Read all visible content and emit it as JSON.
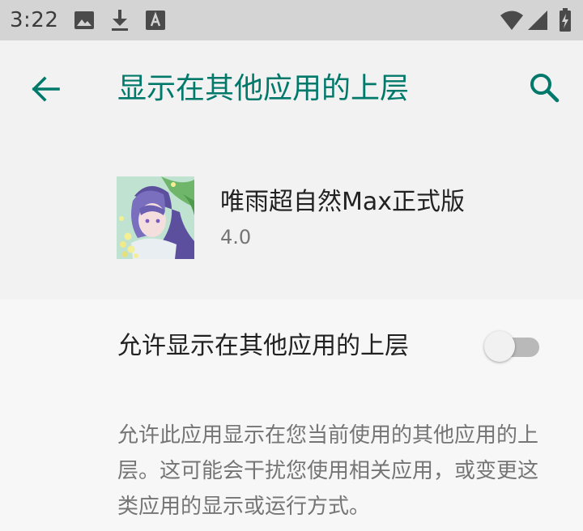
{
  "status_bar": {
    "time": "3:22",
    "icons": [
      "image-icon",
      "download-icon",
      "font-a-icon",
      "wifi-icon",
      "signal-icon",
      "battery-icon"
    ]
  },
  "app_bar": {
    "title": "显示在其他应用的上层",
    "back_icon": "arrow-back-icon",
    "search_icon": "search-icon"
  },
  "app_info": {
    "name": "唯雨超自然Max正式版",
    "version": "4.0"
  },
  "setting": {
    "label": "允许显示在其他应用的上层",
    "enabled": false
  },
  "description": "允许此应用显示在您当前使用的其他应用的上层。这可能会干扰您使用相关应用，或变更这类应用的显示或运行方式。",
  "colors": {
    "accent": "#00796b",
    "status_bar": "#d4d4d4",
    "background": "#f2f2f2"
  }
}
